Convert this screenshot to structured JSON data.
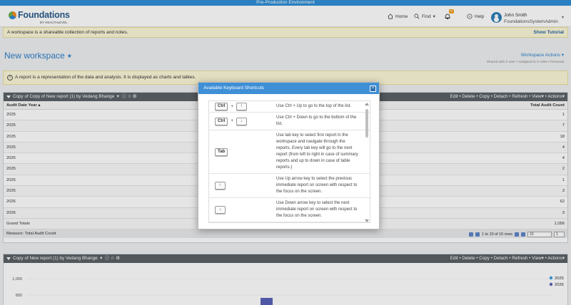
{
  "env_banner": "Pre-Production Environment",
  "brand": {
    "name": "Foundations",
    "tagline": "BY HEALTHLEVEL"
  },
  "nav": {
    "home": "Home",
    "find": "Find",
    "help": "Help",
    "notif_count": "0"
  },
  "user": {
    "name": "John Smith",
    "role": "FoundationsSystemAdmin"
  },
  "workspace_info": {
    "text": "A workspace is a shareable collection of reports and notes.",
    "tutorial": "Show Tutorial"
  },
  "workspace": {
    "title": "New workspace",
    "actions": "Workspace Actions",
    "shared": "Shared with 0 user • Assigned to 0 roles • Personal"
  },
  "report_info": "A report is a representation of the data and analysis. It is displayed as charts and tables.",
  "report1": {
    "title": "Copy of Copy of New report (1) by Vedang Bhange",
    "actions": [
      "Edit",
      "Delete",
      "Copy",
      "Detach",
      "Refresh",
      "View▾",
      "Actions▾"
    ],
    "col1": "Audit Date Year",
    "col2": "Total Audit Count",
    "rows": [
      {
        "year": "2025",
        "count": "1"
      },
      {
        "year": "2025",
        "count": "7"
      },
      {
        "year": "2025",
        "count": "18"
      },
      {
        "year": "2025",
        "count": "4"
      },
      {
        "year": "2025",
        "count": "4"
      },
      {
        "year": "2025",
        "count": "2"
      },
      {
        "year": "2025",
        "count": "1"
      },
      {
        "year": "2025",
        "count": "3"
      },
      {
        "year": "2026",
        "count": "62"
      },
      {
        "year": "2026",
        "count": "3"
      }
    ],
    "grand_label": "Grand Totals",
    "grand_value": "1,056",
    "measure": "Measure: Total Audit Count",
    "pager_text": "1 to 10 of 16 rows",
    "page_size": "10",
    "page_num": "1"
  },
  "report2": {
    "title": "Copy of New report (1) by Vedang Bhange",
    "actions": [
      "Edit",
      "Delete",
      "Copy",
      "Detach",
      "Refresh",
      "View▾",
      "Actions▾"
    ],
    "y_ticks": [
      "1,000",
      "800"
    ],
    "legend": [
      "2025",
      "2026"
    ],
    "colors": {
      "s2025": "#3aa0e0",
      "s2026": "#5a63b8"
    }
  },
  "modal": {
    "title": "Available Keyboard Shortcuts",
    "close": "×",
    "shortcuts": [
      {
        "keys": [
          "Ctrl",
          "↑"
        ],
        "desc": "Use Ctrl + Up to go to the top of the list."
      },
      {
        "keys": [
          "Ctrl",
          "↓"
        ],
        "desc": "Use Ctrl + Down to go to the bottom of the list."
      },
      {
        "keys": [
          "Tab"
        ],
        "desc": "Use tab key to select first report in the workspace and navigate through the reports. Every tab key will go to the next report (from left to right in case of summary reports and up to down in case of table reports.)"
      },
      {
        "keys": [
          "↑"
        ],
        "desc": "Use Up arrow key to select the previous immediate report on screen with respect to the focus on the screen."
      },
      {
        "keys": [
          "↓"
        ],
        "desc": "Use Down arrow key to select the next immediate report on screen with respect to the focus on the screen."
      }
    ]
  }
}
